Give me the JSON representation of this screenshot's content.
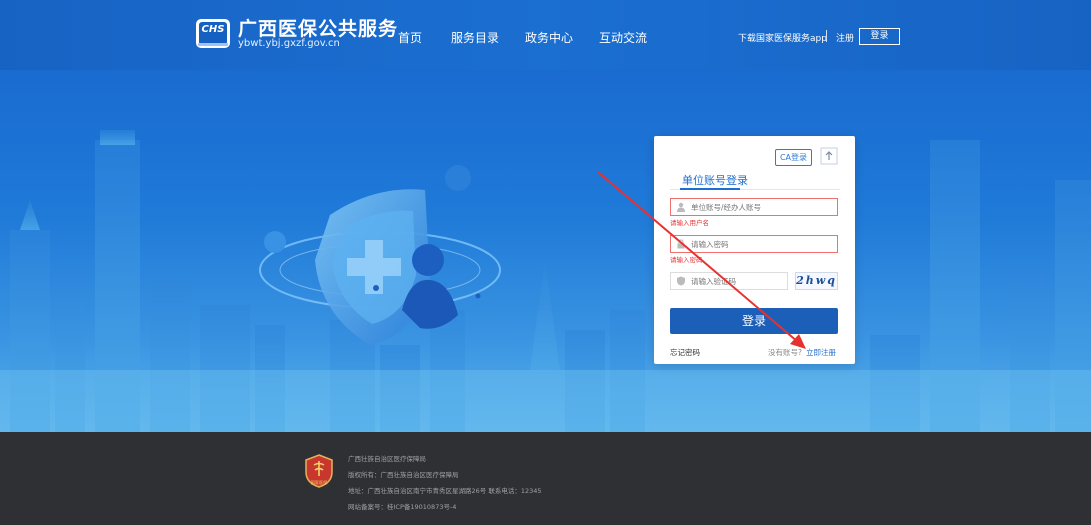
{
  "header": {
    "logo_text": "CHS",
    "title": "广西医保公共服务",
    "url": "ybwt.ybj.gxzf.gov.cn",
    "nav": [
      "首页",
      "服务目录",
      "政务中心",
      "互动交流"
    ],
    "app_download": "下载国家医保服务app",
    "register": "注册",
    "login": "登录"
  },
  "login": {
    "ca_login": "CA登录",
    "tab": "单位账号登录",
    "username_placeholder": "单位账号/经办人账号",
    "username_error": "请输入用户名",
    "password_placeholder": "请输入密码",
    "password_error": "请输入密码",
    "captcha_placeholder": "请输入验证码",
    "captcha_text": "2hwq",
    "submit": "登录",
    "forgot": "忘记密码",
    "no_account": "没有账号?",
    "register_now": "立即注册"
  },
  "footer": {
    "emblem_label": "国家医保",
    "lines": [
      "广西壮族自治区医疗保障局",
      "版权所有：广西壮族自治区医疗保障局",
      "地址：广西壮族自治区南宁市青秀区星湖路26号 联系电话：12345",
      "网站备案号：桂ICP备19010873号-4"
    ]
  },
  "colors": {
    "header": "#1763c4",
    "primary_button": "#1c5fb8",
    "error": "#e53333",
    "footer": "#2f3033",
    "annotation_arrow": "#e8312f"
  }
}
